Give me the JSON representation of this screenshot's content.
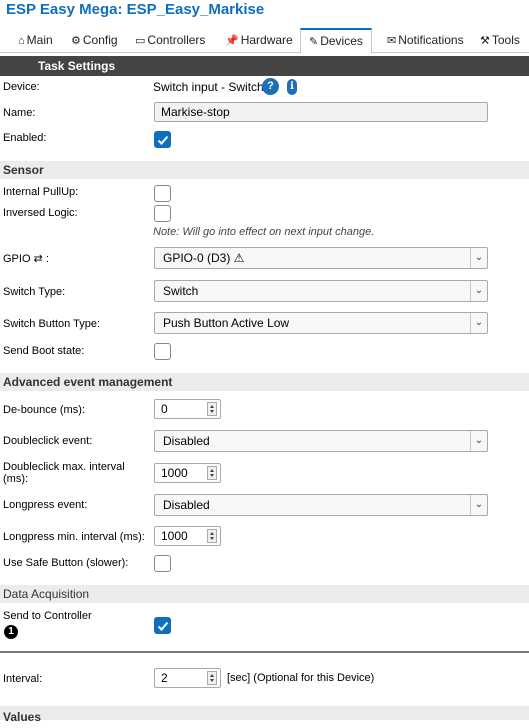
{
  "app_title": "ESP Easy Mega: ESP_Easy_Markise",
  "tabs": [
    {
      "label": "Main",
      "icon": "home-icon"
    },
    {
      "label": "Config",
      "icon": "gear-icon"
    },
    {
      "label": "Controllers",
      "icon": "controllers-icon"
    },
    {
      "label": "Hardware",
      "icon": "pin-icon"
    },
    {
      "label": "Devices",
      "icon": "plug-icon",
      "active": true
    },
    {
      "label": "Notifications",
      "icon": "mail-icon"
    },
    {
      "label": "Tools",
      "icon": "wrench-icon"
    }
  ],
  "task_settings": {
    "header": "Task Settings",
    "device_label": "Device:",
    "device_value": "Switch input - Switch",
    "help_symbol": "?",
    "info_symbol": "i",
    "name_label": "Name:",
    "name_value": "Markise-stop",
    "enabled_label": "Enabled:",
    "enabled_checked": true
  },
  "sensor": {
    "header": "Sensor",
    "internal_pullup_label": "Internal PullUp:",
    "internal_pullup_checked": false,
    "inversed_logic_label": "Inversed Logic:",
    "inversed_logic_checked": false,
    "inversed_note": "Note: Will go into effect on next input change.",
    "gpio_label": "GPIO ⇄ :",
    "gpio_value": "GPIO-0 (D3) ⚠",
    "switch_type_label": "Switch Type:",
    "switch_type_value": "Switch",
    "switch_button_type_label": "Switch Button Type:",
    "switch_button_type_value": "Push Button Active Low",
    "send_boot_state_label": "Send Boot state:",
    "send_boot_state_checked": false
  },
  "advanced": {
    "header": "Advanced event management",
    "debounce_label": "De-bounce (ms):",
    "debounce_value": "0",
    "doubleclick_event_label": "Doubleclick event:",
    "doubleclick_event_value": "Disabled",
    "doubleclick_interval_label_1": "Doubleclick max. interval",
    "doubleclick_interval_label_2": "(ms):",
    "doubleclick_interval_value": "1000",
    "longpress_event_label": "Longpress event:",
    "longpress_event_value": "Disabled",
    "longpress_interval_label": "Longpress min. interval (ms):",
    "longpress_interval_value": "1000",
    "safe_button_label": "Use Safe Button (slower):",
    "safe_button_checked": false
  },
  "data_acquisition": {
    "header": "Data Acquisition",
    "send_to_controller_label": "Send to Controller",
    "controller_badge": "1",
    "controller_checked": true,
    "interval_label": "Interval:",
    "interval_value": "2",
    "interval_unit": "[sec] (Optional for this Device)"
  },
  "values": {
    "header": "Values"
  },
  "colors": {
    "accent": "#0f6fbf",
    "task_header_bg": "#444444",
    "section_bg": "#ececec"
  }
}
